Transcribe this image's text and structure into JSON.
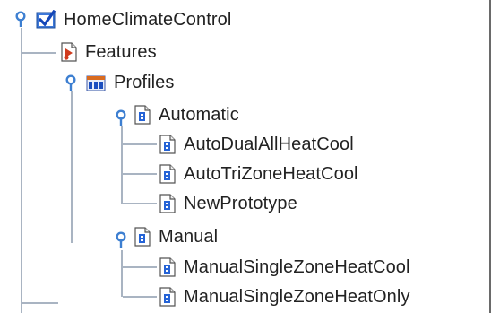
{
  "tree": {
    "root": {
      "label": "HomeClimateControl",
      "icon": "project-check-icon",
      "expanded": true
    },
    "features": {
      "label": "Features",
      "icon": "features-document-icon"
    },
    "profiles": {
      "label": "Profiles",
      "icon": "profiles-folder-icon",
      "expanded": true
    },
    "automatic": {
      "label": "Automatic",
      "icon": "profile-document-icon",
      "expanded": true,
      "items": [
        "AutoDualAllHeatCool",
        "AutoTriZoneHeatCool",
        "NewPrototype"
      ]
    },
    "manual": {
      "label": "Manual",
      "icon": "profile-document-icon",
      "expanded": true,
      "items": [
        "ManualSingleZoneHeatCool",
        "ManualSingleZoneHeatOnly"
      ]
    }
  },
  "colors": {
    "guide_line": "#a9b4c2",
    "toggle": "#3d7fd1",
    "doc_blue": "#2563d6",
    "features_red": "#d03a1d"
  }
}
